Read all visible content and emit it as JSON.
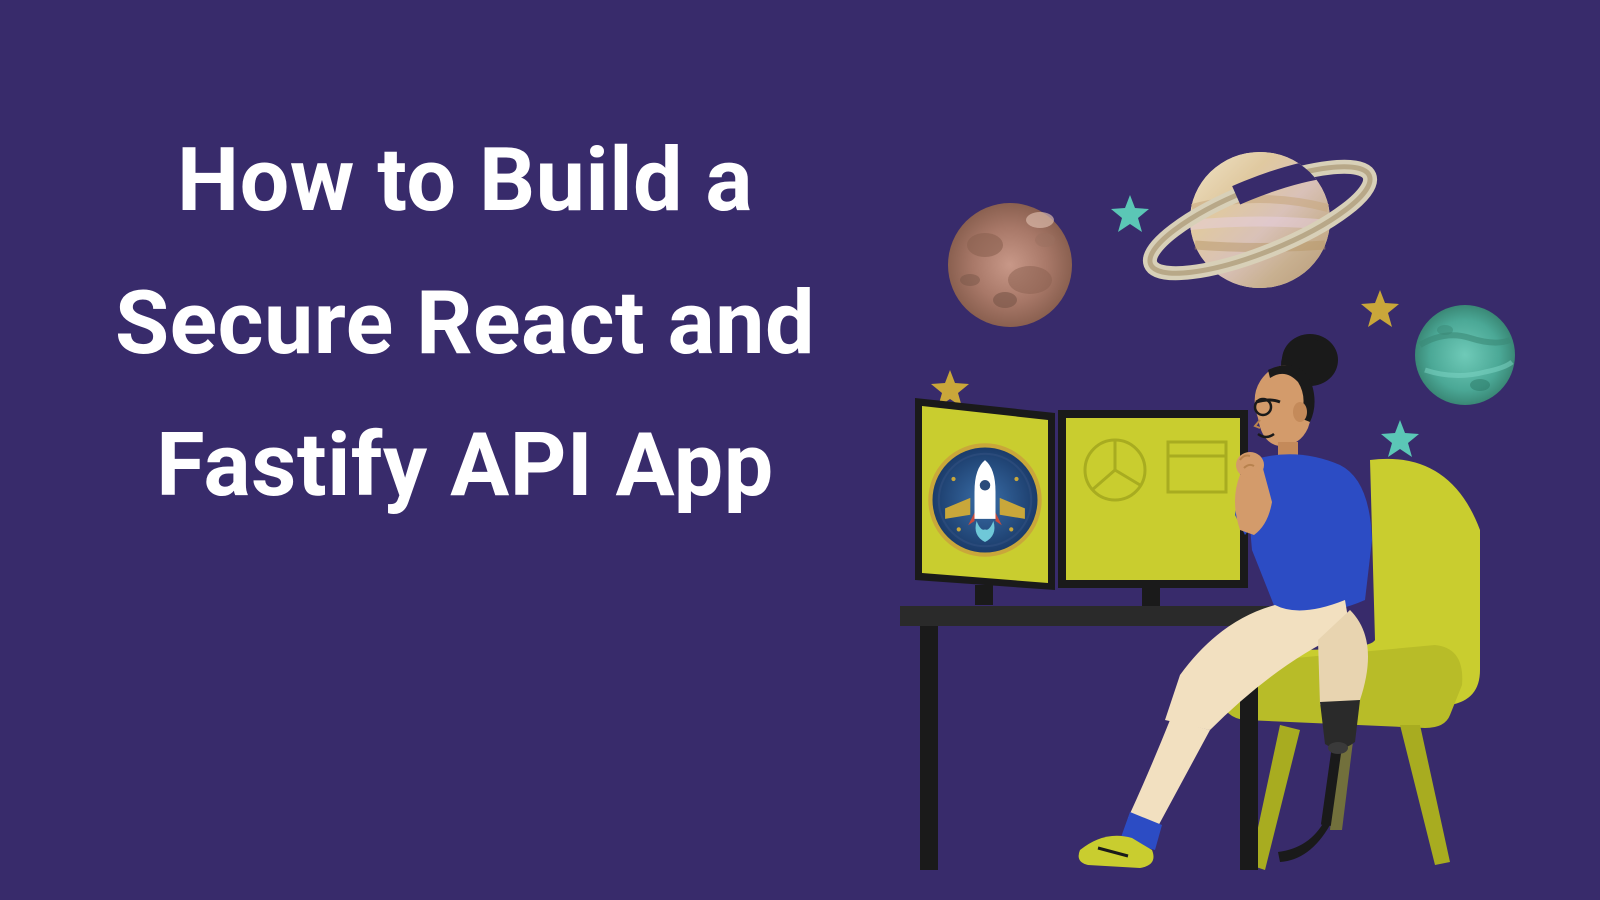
{
  "hero": {
    "title": "How to Build a Secure React and Fastify API App"
  },
  "colors": {
    "background": "#382b6b",
    "text": "#ffffff",
    "accent_yellow": "#c9cd2f",
    "star_gold": "#c9a73a",
    "star_teal": "#5bc7b6",
    "skin": "#d39b6b",
    "shirt": "#2c4cc4",
    "hair": "#1a1a1a",
    "pants": "#f2e0c0"
  },
  "illustration": {
    "description": "Person with prosthetic leg sitting at desk with dual monitors showing rocket badge, surrounded by planets and stars",
    "elements": [
      "mars-planet",
      "saturn-planet",
      "green-planet",
      "gold-star",
      "teal-star",
      "dual-monitor",
      "rocket-badge",
      "desk",
      "chair",
      "person",
      "prosthetic-leg"
    ]
  }
}
